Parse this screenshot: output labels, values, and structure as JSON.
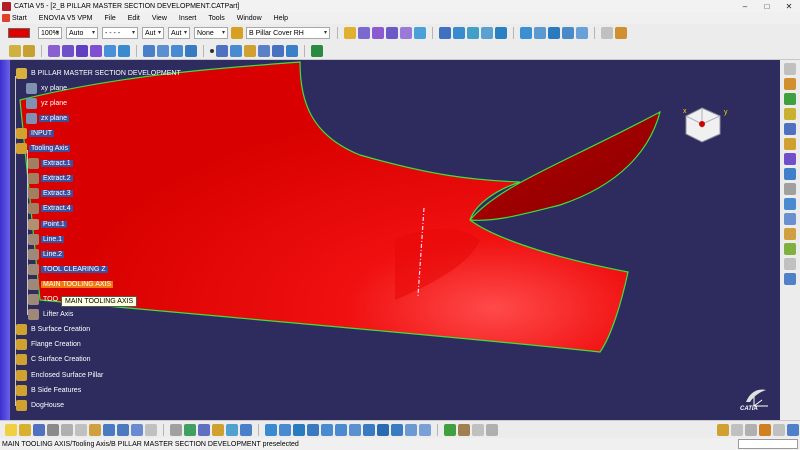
{
  "window": {
    "title": "CATIA V5 - [2_B PILLAR MASTER SECTION DEVELOPMENT.CATPart]",
    "controls": [
      "–",
      "□",
      "✕"
    ]
  },
  "menu": [
    "Start",
    "ENOVIA V5 VPM",
    "File",
    "Edit",
    "View",
    "Insert",
    "Tools",
    "Window",
    "Help"
  ],
  "toolbar": {
    "color": "#e00000",
    "opacity_value": "100%",
    "line_weight": "Auto",
    "line_type": "- - - -",
    "point_type": "Aut",
    "layer": "Aut",
    "none_value": "None",
    "body_select": "B Pillar Cover RH"
  },
  "tree": {
    "items": [
      {
        "label": "B PILLAR MASTER SECTION DEVELOPMENT",
        "icon": "part-icon",
        "state": "normal"
      },
      {
        "label": "xy plane",
        "icon": "plane-icon",
        "state": "normal"
      },
      {
        "label": "yz plane",
        "icon": "plane-icon",
        "state": "normal"
      },
      {
        "label": "zx plane",
        "icon": "plane-icon",
        "state": "selected"
      },
      {
        "label": "INPUT",
        "icon": "geometrical-set-icon",
        "state": "selected"
      },
      {
        "label": "Tooling Axis",
        "icon": "geometrical-set-icon",
        "state": "selected"
      },
      {
        "label": "Extract.1",
        "icon": "extract-icon",
        "state": "selected"
      },
      {
        "label": "Extract.2",
        "icon": "extract-icon",
        "state": "selected"
      },
      {
        "label": "Extract.3",
        "icon": "extract-icon",
        "state": "selected"
      },
      {
        "label": "Extract.4",
        "icon": "extract-icon",
        "state": "selected"
      },
      {
        "label": "Point.1",
        "icon": "point-icon",
        "state": "selected"
      },
      {
        "label": "Line.1",
        "icon": "line-icon",
        "state": "selected"
      },
      {
        "label": "Line.2",
        "icon": "line-icon",
        "state": "selected"
      },
      {
        "label": "TOOL CLEARING Z",
        "icon": "line-icon",
        "state": "selected"
      },
      {
        "label": "MAIN TOOLING AXIS",
        "icon": "line-icon",
        "state": "highlighted"
      },
      {
        "label": "TOO",
        "icon": "line-icon",
        "state": "normal"
      },
      {
        "label": "Lifter Axis",
        "icon": "line-icon",
        "state": "normal"
      },
      {
        "label": "B Surface Creation",
        "icon": "geometrical-set-icon",
        "state": "normal"
      },
      {
        "label": "Flange Creation",
        "icon": "geometrical-set-icon",
        "state": "normal"
      },
      {
        "label": "C Surface Creation",
        "icon": "geometrical-set-icon",
        "state": "normal"
      },
      {
        "label": "Enclosed Surface Pillar",
        "icon": "geometrical-set-icon",
        "state": "normal"
      },
      {
        "label": "B Side Features",
        "icon": "geometrical-set-icon",
        "state": "normal"
      },
      {
        "label": "DogHouse",
        "icon": "geometrical-set-icon",
        "state": "normal"
      }
    ],
    "tooltip": "MAIN TOOLING AXIS"
  },
  "viewport": {
    "background": "#2e2c5e",
    "surface_color": "#e00000",
    "edge_color": "#3ee03e",
    "compass_labels": [
      "x",
      "y"
    ]
  },
  "status": {
    "text": "MAIN TOOLING AXIS/Tooling Axis/B PILLAR MASTER SECTION DEVELOPMENT preselected"
  },
  "logo": "CATIA"
}
